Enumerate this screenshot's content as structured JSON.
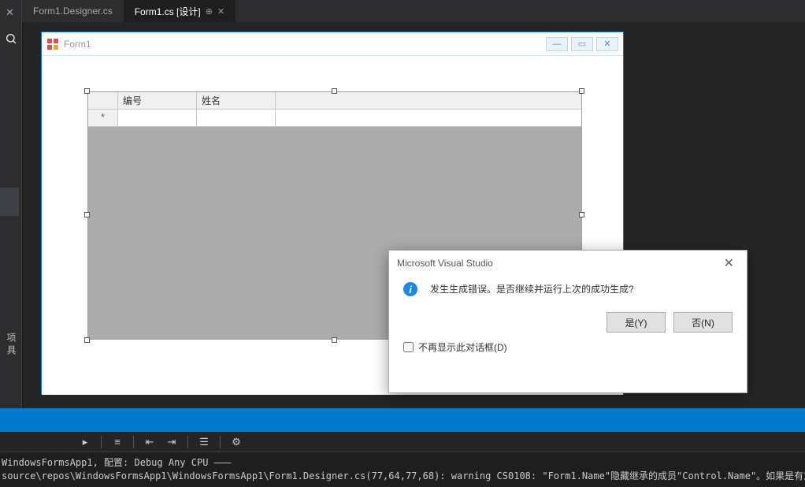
{
  "tabs": [
    {
      "label": "Form1.Designer.cs",
      "active": false
    },
    {
      "label": "Form1.cs [设计]",
      "active": true
    }
  ],
  "sidebar": {
    "vtext": "项具"
  },
  "form": {
    "title": "Form1",
    "columns": [
      "编号",
      "姓名"
    ],
    "new_row_marker": "*"
  },
  "dialog": {
    "title": "Microsoft Visual Studio",
    "message": "发生生成错误。是否继续并运行上次的成功生成?",
    "yes": "是(Y)",
    "no": "否(N)",
    "checkbox": "不再显示此对话框(D)"
  },
  "output": {
    "line1": "WindowsFormsApp1, 配置: Debug Any CPU ———",
    "line2": "source\\repos\\WindowsFormsApp1\\WindowsFormsApp1\\Form1.Designer.cs(77,64,77,68): warning CS0108: \"Form1.Name\"隐藏继承的成员\"Control.Name\"。如果是有意隐藏，请使用关键字 ne"
  }
}
